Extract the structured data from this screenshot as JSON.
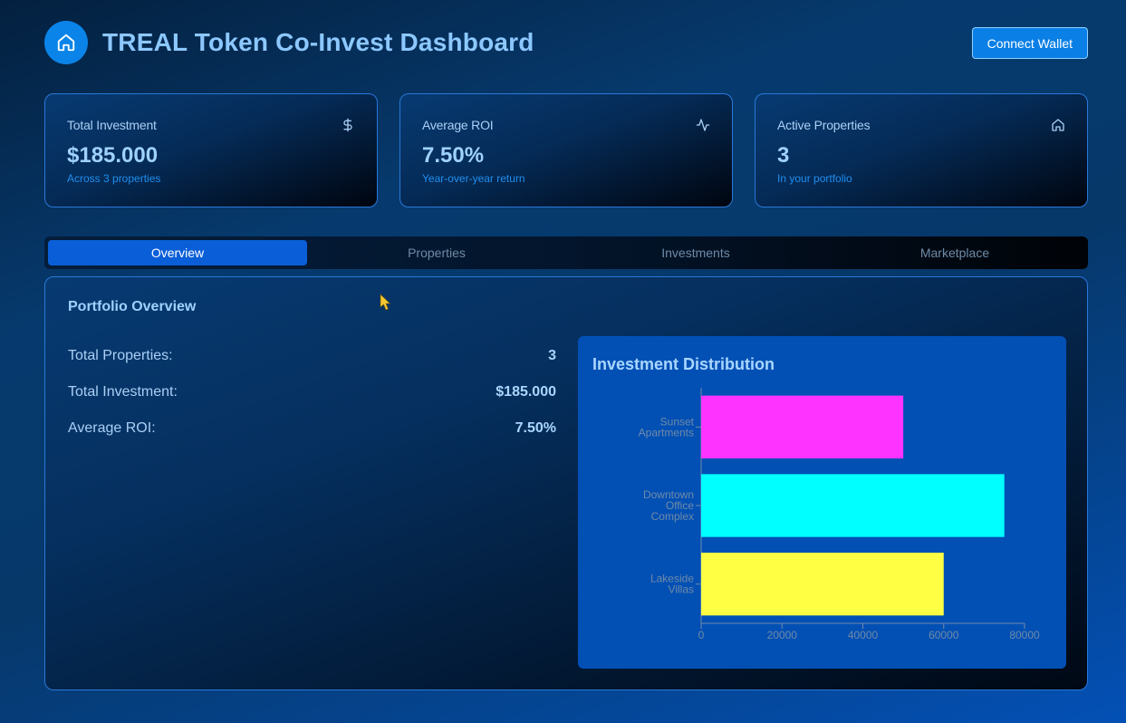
{
  "header": {
    "title": "TREAL Token Co-Invest Dashboard",
    "logo_icon": "home-icon",
    "connect_label": "Connect Wallet"
  },
  "stats": [
    {
      "label": "Total Investment",
      "value": "$185.000",
      "sub": "Across 3 properties",
      "icon": "dollar-icon"
    },
    {
      "label": "Average ROI",
      "value": "7.50%",
      "sub": "Year-over-year return",
      "icon": "activity-icon"
    },
    {
      "label": "Active Properties",
      "value": "3",
      "sub": "In your portfolio",
      "icon": "home-icon"
    }
  ],
  "tabs": [
    "Overview",
    "Properties",
    "Investments",
    "Marketplace"
  ],
  "active_tab": "Overview",
  "overview": {
    "title": "Portfolio Overview",
    "rows": [
      {
        "label": "Total Properties:",
        "value": "3"
      },
      {
        "label": "Total Investment:",
        "value": "$185.000"
      },
      {
        "label": "Average ROI:",
        "value": "7.50%"
      }
    ]
  },
  "chart_data": {
    "type": "bar",
    "orientation": "horizontal",
    "title": "Investment Distribution",
    "categories": [
      "Sunset Apartments",
      "Downtown Office Complex",
      "Lakeside Villas"
    ],
    "values": [
      50000,
      75000,
      60000
    ],
    "colors": [
      "#ff33ff",
      "#00ffff",
      "#ffff44"
    ],
    "xlim": [
      0,
      80000
    ],
    "xticks": [
      0,
      20000,
      40000,
      60000,
      80000
    ],
    "grid": false,
    "legend": "none",
    "xlabel": "",
    "ylabel": ""
  },
  "colors": {
    "accent": "#0a84e8",
    "tab_active": "#0a5fd8",
    "chart_bg": "#0350b5"
  }
}
